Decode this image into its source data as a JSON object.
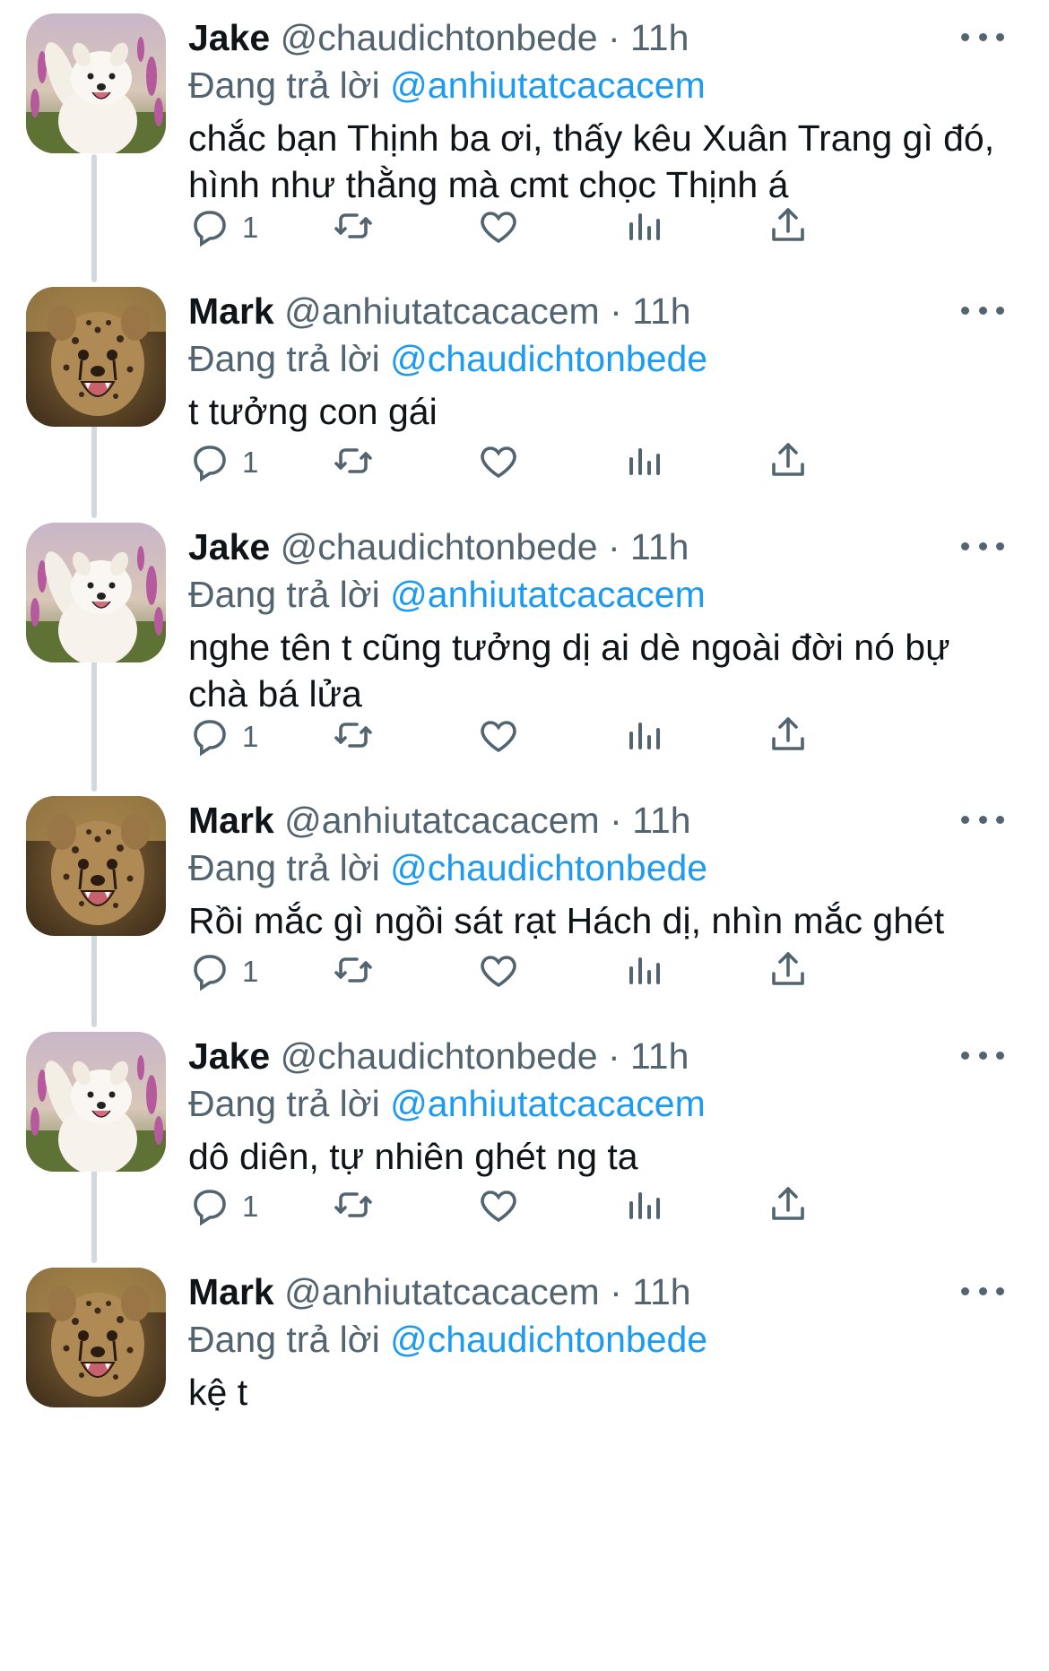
{
  "thread": [
    {
      "user": "Jake",
      "handle": "@chaudichtonbede",
      "separator": "·",
      "time": "11h",
      "reply_prefix": "Đang trả lời",
      "reply_to": "@anhiutatcacacem",
      "text": "chắc bạn Thịnh ba ơi, thấy kêu Xuân Trang gì đó, hình như thằng mà cmt chọc Thịnh á",
      "reply_count": "1",
      "avatar": "dog-avatar"
    },
    {
      "user": "Mark",
      "handle": "@anhiutatcacacem",
      "separator": "·",
      "time": "11h",
      "reply_prefix": "Đang trả lời",
      "reply_to": "@chaudichtonbede",
      "text": "t tưởng con gái",
      "reply_count": "1",
      "avatar": "cheetah-avatar"
    },
    {
      "user": "Jake",
      "handle": "@chaudichtonbede",
      "separator": "·",
      "time": "11h",
      "reply_prefix": "Đang trả lời",
      "reply_to": "@anhiutatcacacem",
      "text": "nghe tên t cũng tưởng dị ai dè ngoài đời nó bự chà bá lửa",
      "reply_count": "1",
      "avatar": "dog-avatar"
    },
    {
      "user": "Mark",
      "handle": "@anhiutatcacacem",
      "separator": "·",
      "time": "11h",
      "reply_prefix": "Đang trả lời",
      "reply_to": "@chaudichtonbede",
      "text": "Rồi mắc gì ngồi sát rạt Hách dị, nhìn mắc ghét",
      "reply_count": "1",
      "avatar": "cheetah-avatar"
    },
    {
      "user": "Jake",
      "handle": "@chaudichtonbede",
      "separator": "·",
      "time": "11h",
      "reply_prefix": "Đang trả lời",
      "reply_to": "@anhiutatcacacem",
      "text": "dô diên, tự nhiên ghét ng ta",
      "reply_count": "1",
      "avatar": "dog-avatar"
    },
    {
      "user": "Mark",
      "handle": "@anhiutatcacacem",
      "separator": "·",
      "time": "11h",
      "reply_prefix": "Đang trả lời",
      "reply_to": "@chaudichtonbede",
      "text": "kệ t",
      "reply_count": "",
      "avatar": "cheetah-avatar"
    }
  ],
  "icons": {
    "reply": "comment-icon",
    "retweet": "retweet-icon",
    "like": "heart-icon",
    "views": "analytics-icon",
    "share": "share-icon",
    "more": "more-dots-icon"
  },
  "colors": {
    "text": "#0f1419",
    "muted": "#536471",
    "link": "#1d9bf0",
    "thread_line": "#cfd9de"
  }
}
